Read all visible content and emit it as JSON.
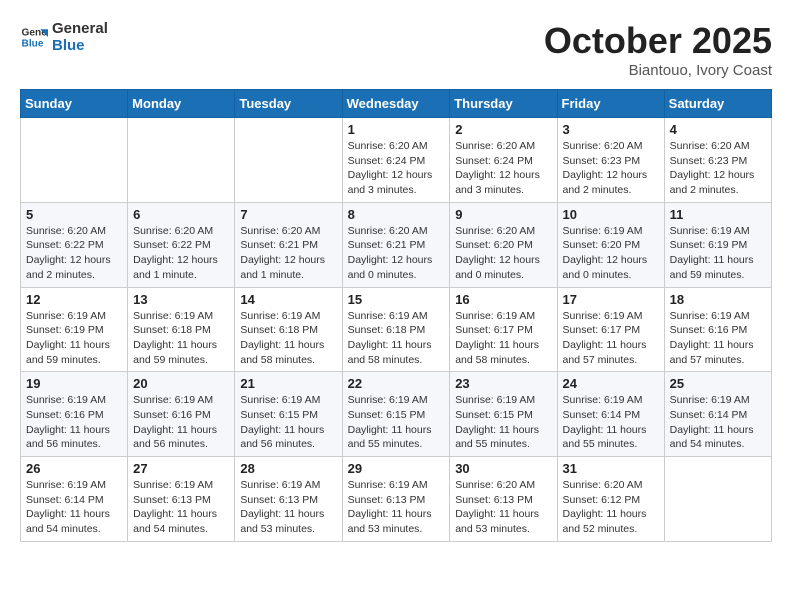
{
  "logo": {
    "line1": "General",
    "line2": "Blue"
  },
  "title": "October 2025",
  "subtitle": "Biantouo, Ivory Coast",
  "days_of_week": [
    "Sunday",
    "Monday",
    "Tuesday",
    "Wednesday",
    "Thursday",
    "Friday",
    "Saturday"
  ],
  "weeks": [
    [
      {
        "day": "",
        "info": ""
      },
      {
        "day": "",
        "info": ""
      },
      {
        "day": "",
        "info": ""
      },
      {
        "day": "1",
        "info": "Sunrise: 6:20 AM\nSunset: 6:24 PM\nDaylight: 12 hours\nand 3 minutes."
      },
      {
        "day": "2",
        "info": "Sunrise: 6:20 AM\nSunset: 6:24 PM\nDaylight: 12 hours\nand 3 minutes."
      },
      {
        "day": "3",
        "info": "Sunrise: 6:20 AM\nSunset: 6:23 PM\nDaylight: 12 hours\nand 2 minutes."
      },
      {
        "day": "4",
        "info": "Sunrise: 6:20 AM\nSunset: 6:23 PM\nDaylight: 12 hours\nand 2 minutes."
      }
    ],
    [
      {
        "day": "5",
        "info": "Sunrise: 6:20 AM\nSunset: 6:22 PM\nDaylight: 12 hours\nand 2 minutes."
      },
      {
        "day": "6",
        "info": "Sunrise: 6:20 AM\nSunset: 6:22 PM\nDaylight: 12 hours\nand 1 minute."
      },
      {
        "day": "7",
        "info": "Sunrise: 6:20 AM\nSunset: 6:21 PM\nDaylight: 12 hours\nand 1 minute."
      },
      {
        "day": "8",
        "info": "Sunrise: 6:20 AM\nSunset: 6:21 PM\nDaylight: 12 hours\nand 0 minutes."
      },
      {
        "day": "9",
        "info": "Sunrise: 6:20 AM\nSunset: 6:20 PM\nDaylight: 12 hours\nand 0 minutes."
      },
      {
        "day": "10",
        "info": "Sunrise: 6:19 AM\nSunset: 6:20 PM\nDaylight: 12 hours\nand 0 minutes."
      },
      {
        "day": "11",
        "info": "Sunrise: 6:19 AM\nSunset: 6:19 PM\nDaylight: 11 hours\nand 59 minutes."
      }
    ],
    [
      {
        "day": "12",
        "info": "Sunrise: 6:19 AM\nSunset: 6:19 PM\nDaylight: 11 hours\nand 59 minutes."
      },
      {
        "day": "13",
        "info": "Sunrise: 6:19 AM\nSunset: 6:18 PM\nDaylight: 11 hours\nand 59 minutes."
      },
      {
        "day": "14",
        "info": "Sunrise: 6:19 AM\nSunset: 6:18 PM\nDaylight: 11 hours\nand 58 minutes."
      },
      {
        "day": "15",
        "info": "Sunrise: 6:19 AM\nSunset: 6:18 PM\nDaylight: 11 hours\nand 58 minutes."
      },
      {
        "day": "16",
        "info": "Sunrise: 6:19 AM\nSunset: 6:17 PM\nDaylight: 11 hours\nand 58 minutes."
      },
      {
        "day": "17",
        "info": "Sunrise: 6:19 AM\nSunset: 6:17 PM\nDaylight: 11 hours\nand 57 minutes."
      },
      {
        "day": "18",
        "info": "Sunrise: 6:19 AM\nSunset: 6:16 PM\nDaylight: 11 hours\nand 57 minutes."
      }
    ],
    [
      {
        "day": "19",
        "info": "Sunrise: 6:19 AM\nSunset: 6:16 PM\nDaylight: 11 hours\nand 56 minutes."
      },
      {
        "day": "20",
        "info": "Sunrise: 6:19 AM\nSunset: 6:16 PM\nDaylight: 11 hours\nand 56 minutes."
      },
      {
        "day": "21",
        "info": "Sunrise: 6:19 AM\nSunset: 6:15 PM\nDaylight: 11 hours\nand 56 minutes."
      },
      {
        "day": "22",
        "info": "Sunrise: 6:19 AM\nSunset: 6:15 PM\nDaylight: 11 hours\nand 55 minutes."
      },
      {
        "day": "23",
        "info": "Sunrise: 6:19 AM\nSunset: 6:15 PM\nDaylight: 11 hours\nand 55 minutes."
      },
      {
        "day": "24",
        "info": "Sunrise: 6:19 AM\nSunset: 6:14 PM\nDaylight: 11 hours\nand 55 minutes."
      },
      {
        "day": "25",
        "info": "Sunrise: 6:19 AM\nSunset: 6:14 PM\nDaylight: 11 hours\nand 54 minutes."
      }
    ],
    [
      {
        "day": "26",
        "info": "Sunrise: 6:19 AM\nSunset: 6:14 PM\nDaylight: 11 hours\nand 54 minutes."
      },
      {
        "day": "27",
        "info": "Sunrise: 6:19 AM\nSunset: 6:13 PM\nDaylight: 11 hours\nand 54 minutes."
      },
      {
        "day": "28",
        "info": "Sunrise: 6:19 AM\nSunset: 6:13 PM\nDaylight: 11 hours\nand 53 minutes."
      },
      {
        "day": "29",
        "info": "Sunrise: 6:19 AM\nSunset: 6:13 PM\nDaylight: 11 hours\nand 53 minutes."
      },
      {
        "day": "30",
        "info": "Sunrise: 6:20 AM\nSunset: 6:13 PM\nDaylight: 11 hours\nand 53 minutes."
      },
      {
        "day": "31",
        "info": "Sunrise: 6:20 AM\nSunset: 6:12 PM\nDaylight: 11 hours\nand 52 minutes."
      },
      {
        "day": "",
        "info": ""
      }
    ]
  ]
}
